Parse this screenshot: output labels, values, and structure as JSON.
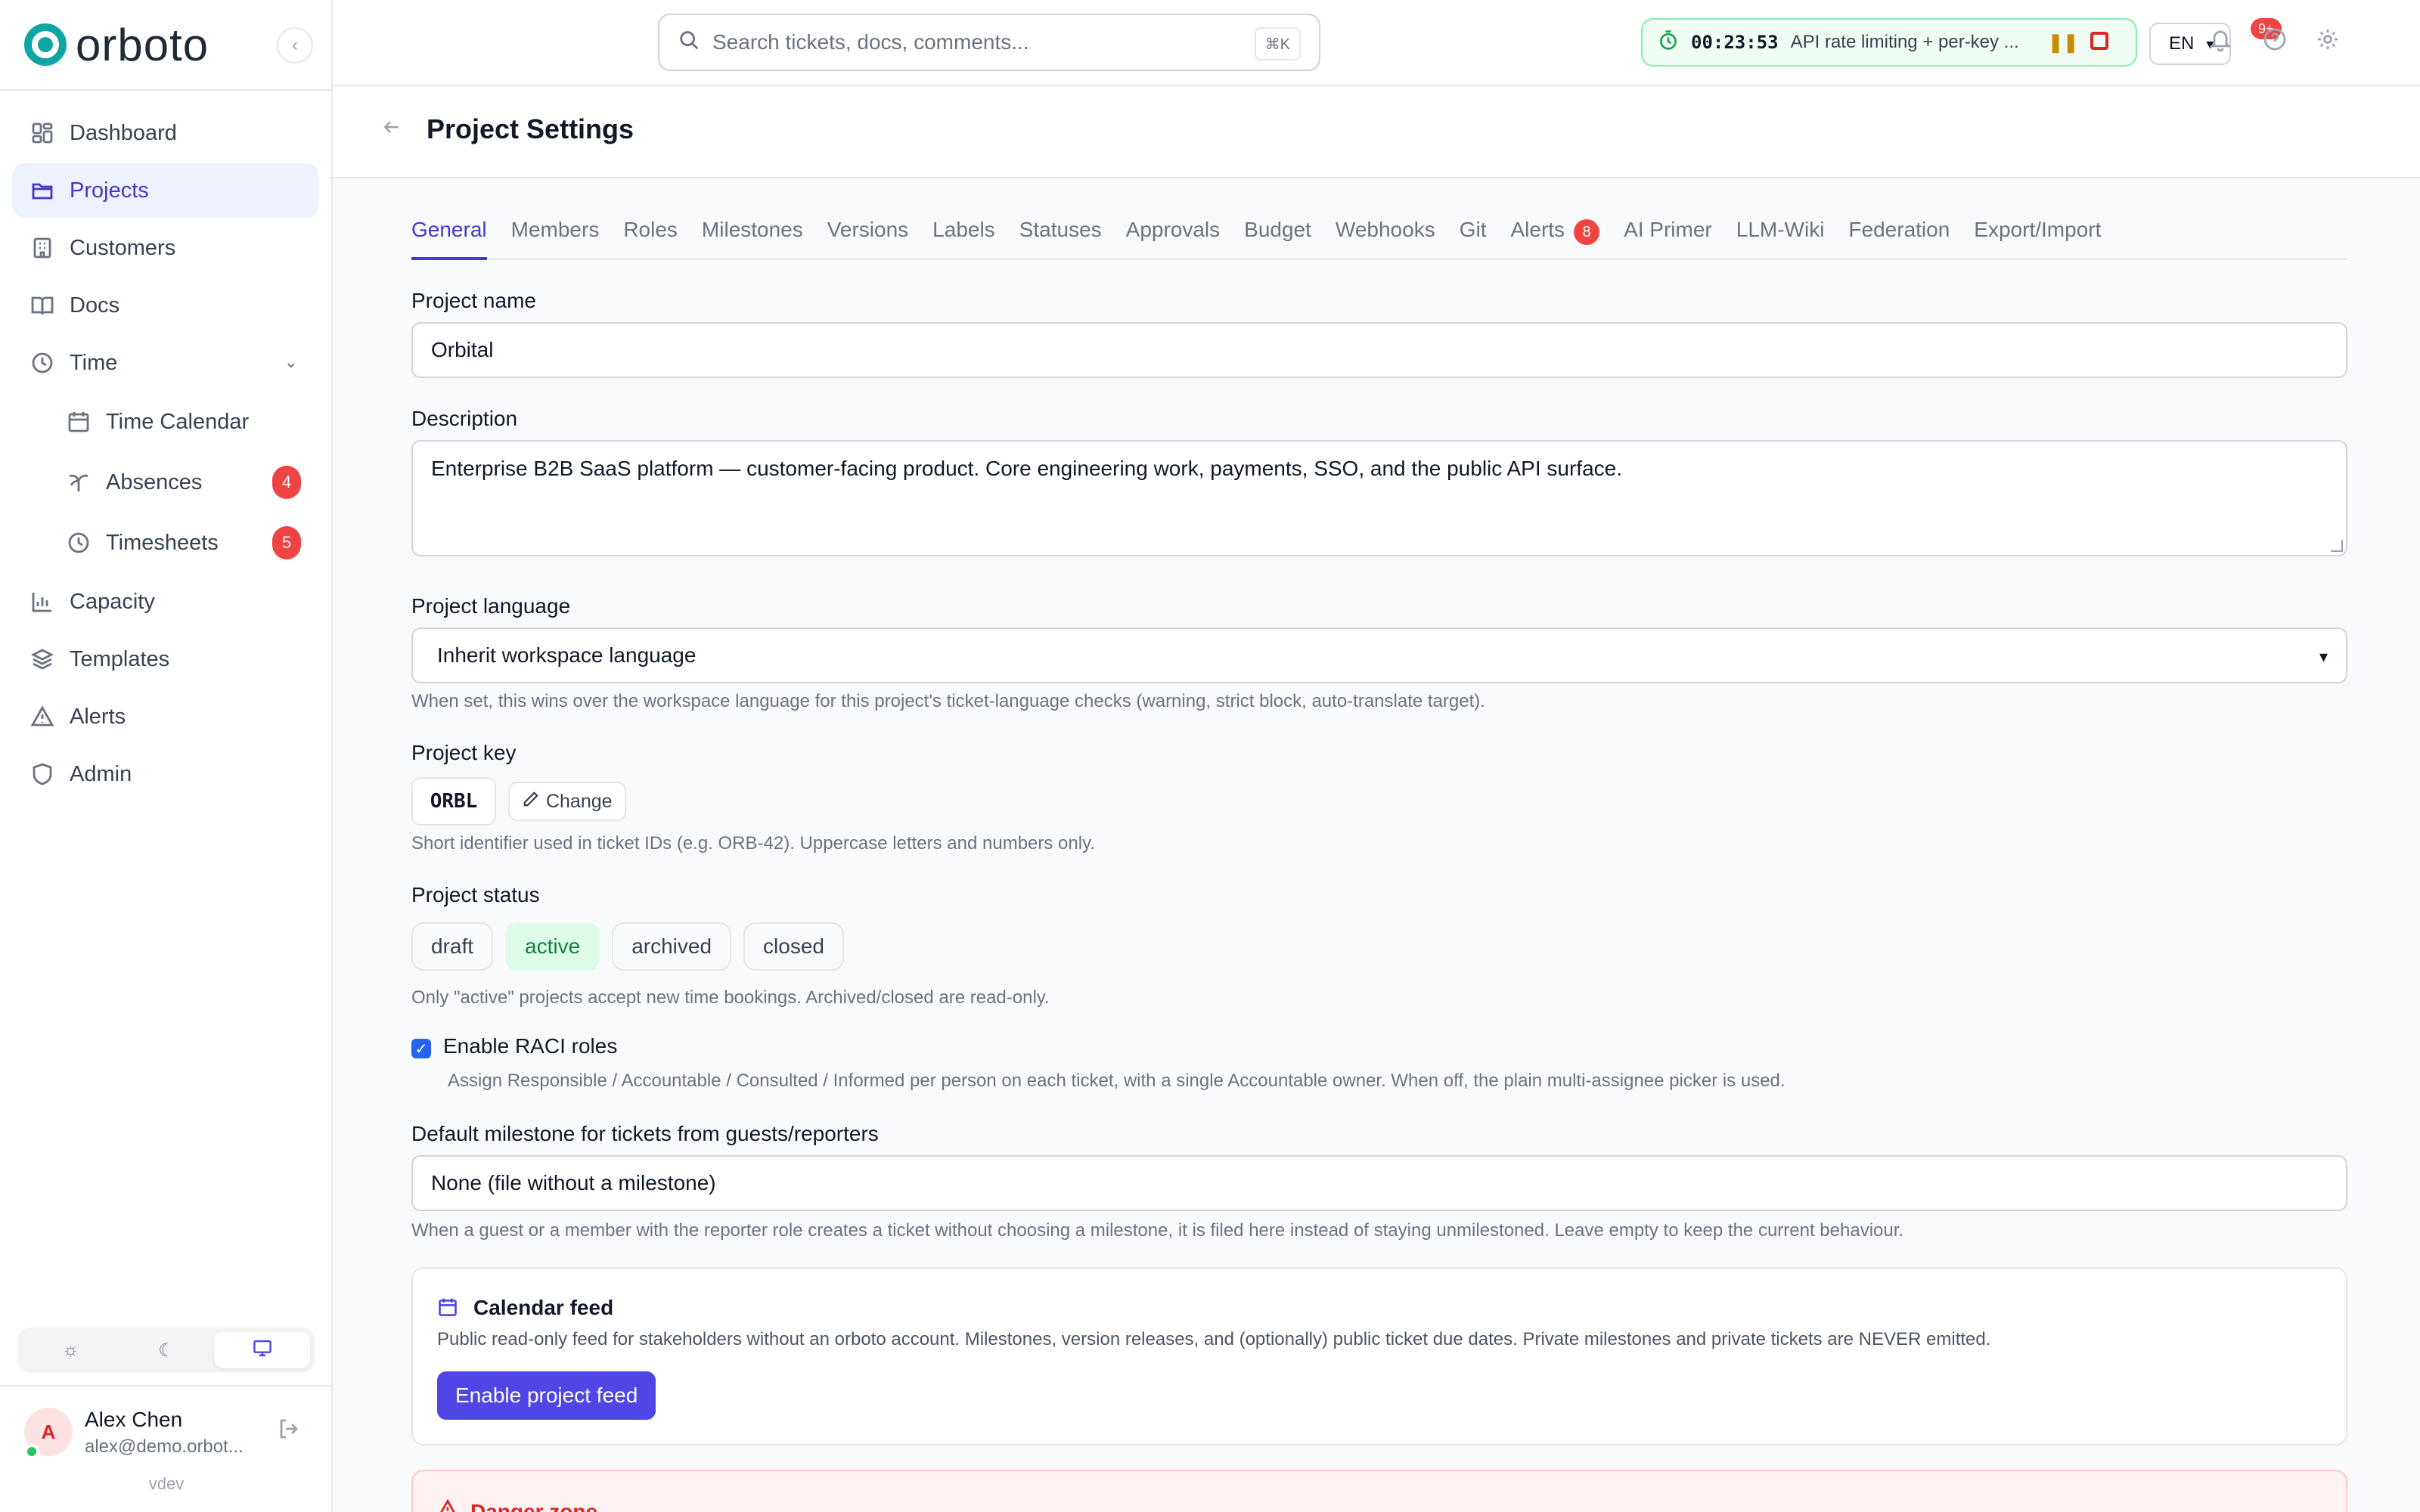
{
  "app": {
    "name": "orboto",
    "version": "vdev"
  },
  "sidebar": {
    "items": [
      {
        "label": "Dashboard",
        "icon": "dashboard-icon"
      },
      {
        "label": "Projects",
        "icon": "folder-icon",
        "active": true
      },
      {
        "label": "Customers",
        "icon": "building-icon"
      },
      {
        "label": "Docs",
        "icon": "book-icon"
      },
      {
        "label": "Time",
        "icon": "clock-icon"
      }
    ],
    "time_sub": [
      {
        "label": "Time Calendar",
        "icon": "calendar-icon"
      },
      {
        "label": "Absences",
        "icon": "palm-tree-icon",
        "badge": "4"
      },
      {
        "label": "Timesheets",
        "icon": "clock-icon",
        "badge": "5"
      }
    ],
    "items2": [
      {
        "label": "Capacity",
        "icon": "bar-chart-icon"
      },
      {
        "label": "Templates",
        "icon": "layers-icon"
      },
      {
        "label": "Alerts",
        "icon": "alert-icon"
      },
      {
        "label": "Admin",
        "icon": "shield-icon"
      }
    ],
    "user": {
      "initial": "A",
      "name": "Alex Chen",
      "email": "alex@demo.orbot..."
    }
  },
  "topbar": {
    "search_placeholder": "Search tickets, docs, comments...",
    "search_shortcut": "⌘K",
    "timer": {
      "time": "00:23:53",
      "task": "API rate limiting + per-key ..."
    },
    "language": "EN",
    "notifications_badge": "9+"
  },
  "page": {
    "title": "Project Settings",
    "tabs": [
      {
        "label": "General",
        "active": true
      },
      {
        "label": "Members"
      },
      {
        "label": "Roles"
      },
      {
        "label": "Milestones"
      },
      {
        "label": "Versions"
      },
      {
        "label": "Labels"
      },
      {
        "label": "Statuses"
      },
      {
        "label": "Approvals"
      },
      {
        "label": "Budget"
      },
      {
        "label": "Webhooks"
      },
      {
        "label": "Git"
      },
      {
        "label": "Alerts",
        "badge": "8"
      },
      {
        "label": "AI Primer"
      },
      {
        "label": "LLM-Wiki"
      },
      {
        "label": "Federation"
      },
      {
        "label": "Export/Import"
      }
    ]
  },
  "form": {
    "name_label": "Project name",
    "name_value": "Orbital",
    "description_label": "Description",
    "description_value": "Enterprise B2B SaaS platform — customer-facing product. Core engineering work, payments, SSO, and the public API surface.",
    "language_label": "Project language",
    "language_value": "Inherit workspace language",
    "language_help": "When set, this wins over the workspace language for this project's ticket-language checks (warning, strict block, auto-translate target).",
    "key_label": "Project key",
    "key_value": "ORBL",
    "key_change": "Change",
    "key_help": "Short identifier used in ticket IDs (e.g. ORB-42). Uppercase letters and numbers only.",
    "status_label": "Project status",
    "statuses": [
      "draft",
      "active",
      "archived",
      "closed"
    ],
    "status_selected": "active",
    "status_help": "Only \"active\" projects accept new time bookings. Archived/closed are read-only.",
    "raci_label": "Enable RACI roles",
    "raci_checked": true,
    "raci_help": "Assign Responsible / Accountable / Consulted / Informed per person on each ticket, with a single Accountable owner. When off, the plain multi-assignee picker is used.",
    "milestone_label": "Default milestone for tickets from guests/reporters",
    "milestone_value": "None (file without a milestone)",
    "milestone_help": "When a guest or a member with the reporter role creates a ticket without choosing a milestone, it is filed here instead of staying unmilestoned. Leave empty to keep the current behaviour.",
    "calendar_title": "Calendar feed",
    "calendar_desc": "Public read-only feed for stakeholders without an orboto account. Milestones, version releases, and (optionally) public ticket due dates. Private milestones and private tickets are NEVER emitted.",
    "calendar_button": "Enable project feed",
    "danger_title": "Danger zone"
  },
  "colors": {
    "accent": "#4f46e5",
    "active_status": "#15803d",
    "badge": "#ef4444",
    "brand": "#0ea5a4"
  }
}
